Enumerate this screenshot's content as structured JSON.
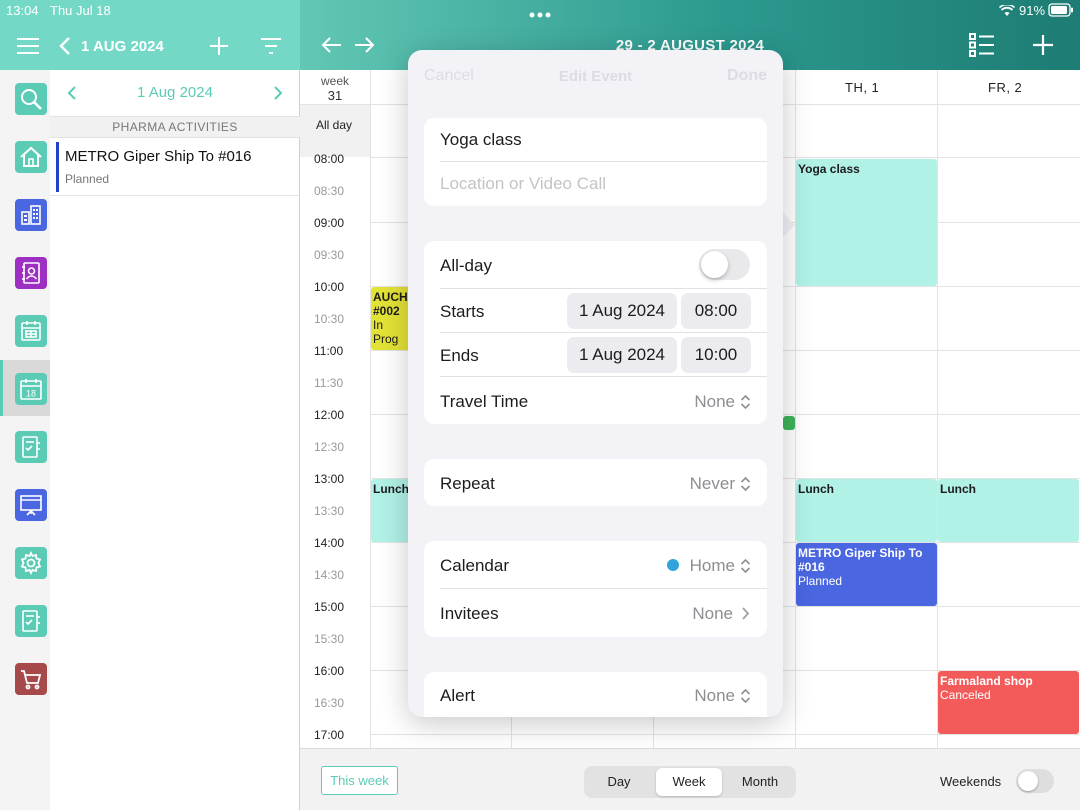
{
  "status": {
    "time": "13:04",
    "date": "Thu Jul 18",
    "battery": "91%"
  },
  "header": {
    "left_date": "1 AUG 2024",
    "week_title": "29 - 2 AUGUST 2024",
    "accent_color": "#74d8c6"
  },
  "sidebar": {
    "items": [
      {
        "icon": "search-icon",
        "color": "#5ccbb6"
      },
      {
        "icon": "home-icon",
        "color": "#5ccbb6"
      },
      {
        "icon": "buildings-icon",
        "color": "#4a66e0"
      },
      {
        "icon": "contacts-book-icon",
        "color": "#9d2fc2"
      },
      {
        "icon": "calendar-grid-icon",
        "color": "#5ccbb6"
      },
      {
        "icon": "calendar-18-icon",
        "color": "#5ccbb6",
        "badge": "18",
        "selected": true
      },
      {
        "icon": "checklist-icon",
        "color": "#5ccbb6"
      },
      {
        "icon": "presentation-icon",
        "color": "#4a66e0"
      },
      {
        "icon": "gear-icon",
        "color": "#5ccbb6"
      },
      {
        "icon": "checklist-icon",
        "color": "#5ccbb6"
      },
      {
        "icon": "cart-icon",
        "color": "#a6494a"
      }
    ]
  },
  "list_panel": {
    "date": "1 Aug 2024",
    "section": "PHARMA ACTIVITIES",
    "item": {
      "title": "METRO Giper Ship To #016",
      "status": "Planned"
    }
  },
  "calendar": {
    "week_label": "week",
    "week_number": "31",
    "all_day_label": "All day",
    "days": [
      {
        "label": "TH,  1"
      },
      {
        "label": "FR,  2"
      }
    ],
    "times": [
      "08:00",
      "08:30",
      "09:00",
      "09:30",
      "10:00",
      "10:30",
      "11:00",
      "11:30",
      "12:00",
      "12:30",
      "13:00",
      "13:30",
      "14:00",
      "14:30",
      "15:00",
      "15:30",
      "16:00",
      "16:30",
      "17:00"
    ],
    "events": {
      "auchan": {
        "title": "AUCHA",
        "line2": "#002",
        "status": "In Prog",
        "color": "#e3e236"
      },
      "lunch_mon": {
        "title": "Lunch",
        "color": "#b1f1e6"
      },
      "yoga": {
        "title": "Yoga class",
        "color": "#b1f1e6"
      },
      "lunch_thu": {
        "title": "Lunch",
        "color": "#b1f1e6"
      },
      "metro": {
        "title": "METRO Giper Ship To #016",
        "status": "Planned",
        "color": "#4a66e0"
      },
      "lunch_fri": {
        "title": "Lunch",
        "color": "#b1f1e6"
      },
      "farmaland": {
        "title": "Farmaland shop",
        "status": "Canceled",
        "color": "#f35b5b"
      }
    }
  },
  "bottom_bar": {
    "this_week": "This week",
    "views": [
      "Day",
      "Week",
      "Month"
    ],
    "active_view": "Week",
    "weekends_label": "Weekends"
  },
  "modal": {
    "cancel": "Cancel",
    "title": "Edit Event",
    "done": "Done",
    "event_title": "Yoga class",
    "location_placeholder": "Location or Video Call",
    "all_day_label": "All-day",
    "starts_label": "Starts",
    "starts_date": "1 Aug 2024",
    "starts_time": "08:00",
    "ends_label": "Ends",
    "ends_date": "1 Aug 2024",
    "ends_time": "10:00",
    "travel_label": "Travel Time",
    "travel_value": "None",
    "repeat_label": "Repeat",
    "repeat_value": "Never",
    "calendar_label": "Calendar",
    "calendar_value": "Home",
    "calendar_color": "#32a4dc",
    "invitees_label": "Invitees",
    "invitees_value": "None",
    "alert_label": "Alert",
    "alert_value": "None"
  }
}
